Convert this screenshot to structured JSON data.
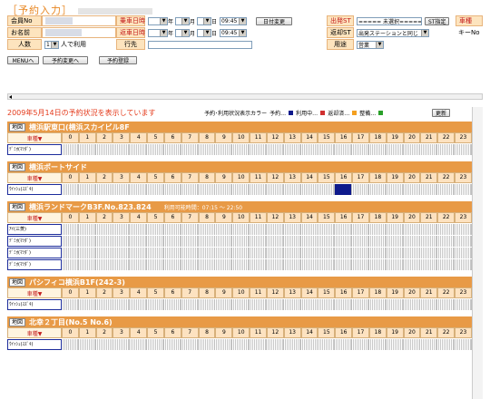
{
  "header": {
    "title": "［予約入力］"
  },
  "form": {
    "member_no_label": "会員No",
    "name_label": "お名前",
    "people_label": "人数",
    "people_value": "1",
    "people_suffix": "人で利用",
    "dest_label": "行先",
    "ride_label": "乗車日時",
    "return_label": "返車日時",
    "year": "年",
    "month": "月",
    "day": "日",
    "ride_time": "09:45",
    "return_time": "09:45",
    "change_date_btn": "日付変更",
    "depart_st_label": "出発ST",
    "depart_st_value": "===== 未選択=====",
    "st_select_btn": "ST指定",
    "return_st_label": "返却ST",
    "return_st_value": "出発ステーションと同じ",
    "usage_label": "用途",
    "usage_value": "営業",
    "car_type_label": "車種",
    "key_no_label": "キーNo"
  },
  "buttons": {
    "menu": "MENUへ",
    "change": "予約変更へ",
    "register": "予約登録"
  },
  "status": {
    "date_text": "2009年5月14日の予約状況を表示しています",
    "legend_title": "予約･利用状況表示カラー",
    "legend_items": [
      {
        "label": "予約…",
        "color": "#0e1a8c"
      },
      {
        "label": "利用中…",
        "color": "#d03030"
      },
      {
        "label": "返却済…",
        "color": "#f4a020"
      },
      {
        "label": "整備…",
        "color": "#2aa02a"
      }
    ],
    "refresh_btn": "更新"
  },
  "hours": [
    "0",
    "1",
    "2",
    "3",
    "4",
    "5",
    "6",
    "7",
    "8",
    "9",
    "10",
    "11",
    "12",
    "13",
    "14",
    "15",
    "16",
    "17",
    "18",
    "19",
    "20",
    "21",
    "22",
    "23"
  ],
  "stations": [
    {
      "map": "地図",
      "name": "横浜駅東口(横浜スカイビル8F",
      "extra": "",
      "car_header": "車種▼",
      "cars": [
        {
          "name": "ﾃﾞﾐｵ(ﾏﾂﾀﾞ)",
          "booked": []
        }
      ]
    },
    {
      "map": "地図",
      "name": "横浜ポートサイド",
      "extra": "",
      "car_header": "車種▼",
      "cars": [
        {
          "name": "ｳｲｯｼｭ(ｽｽﾞｷ)",
          "booked": [
            16
          ]
        }
      ]
    },
    {
      "map": "地図",
      "name": "横浜ランドマークB3F.No.823.824",
      "extra": "利用可能時間：07:15 ～ 22:50",
      "car_header": "車種▼",
      "cars": [
        {
          "name": "ｱｲ(三菱)",
          "booked": []
        },
        {
          "name": "ﾃﾞﾐｵ(ﾏﾂﾀﾞ)",
          "booked": []
        },
        {
          "name": "ﾃﾞﾐｵ(ﾏﾂﾀﾞ)",
          "booked": []
        },
        {
          "name": "ﾃﾞﾐｵ(ﾏﾂﾀﾞ)",
          "booked": []
        }
      ]
    },
    {
      "map": "地図",
      "name": "パシフィコ横浜B1F(242-3)",
      "extra": "",
      "car_header": "車種▼",
      "cars": [
        {
          "name": "ｳｲｯｼｭ(ｽｽﾞｷ)",
          "booked": []
        }
      ]
    },
    {
      "map": "地図",
      "name": "北幸２丁目(No.5 No.6)",
      "extra": "",
      "car_header": "車種▼",
      "cars": [
        {
          "name": "ｳｲｯｼｭ(ｽｽﾞｷ)",
          "booked": []
        }
      ]
    }
  ]
}
